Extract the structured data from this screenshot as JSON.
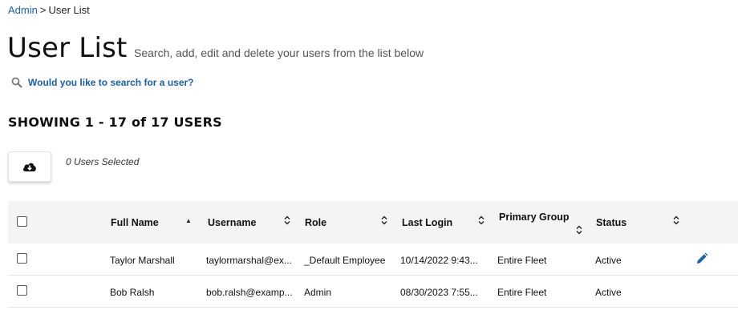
{
  "breadcrumb": {
    "root": "Admin",
    "separator": ">",
    "current": "User List"
  },
  "page": {
    "title": "User List",
    "subtitle": "Search, add, edit and delete your users from the list below"
  },
  "search": {
    "link_text": "Would you like to search for a user?"
  },
  "summary": {
    "showing": "SHOWING 1 - 17 of 17 USERS",
    "selected": "0 Users Selected"
  },
  "table": {
    "columns": [
      "Full Name",
      "Username",
      "Role",
      "Last Login",
      "Primary Group",
      "Status"
    ],
    "rows": [
      {
        "full_name": "Taylor Marshall",
        "username": "taylormarshal@ex...",
        "role": "_Default Employee",
        "last_login": "10/14/2022 9:43...",
        "primary_group": "Entire Fleet",
        "status": "Active",
        "editable": true
      },
      {
        "full_name": "Bob Ralsh",
        "username": "bob.ralsh@examp...",
        "role": "Admin",
        "last_login": "08/30/2023 7:55...",
        "primary_group": "Entire Fleet",
        "status": "Active",
        "editable": false
      }
    ]
  },
  "icons": {
    "search": "search-icon",
    "download": "cloud-download-icon",
    "edit": "pencil-icon",
    "sort_asc": "sort-asc-icon",
    "sort": "sort-icon"
  },
  "colors": {
    "link": "#1a5fa8",
    "header_bg": "#f4f4f4",
    "edit_icon": "#1a5fa8"
  }
}
